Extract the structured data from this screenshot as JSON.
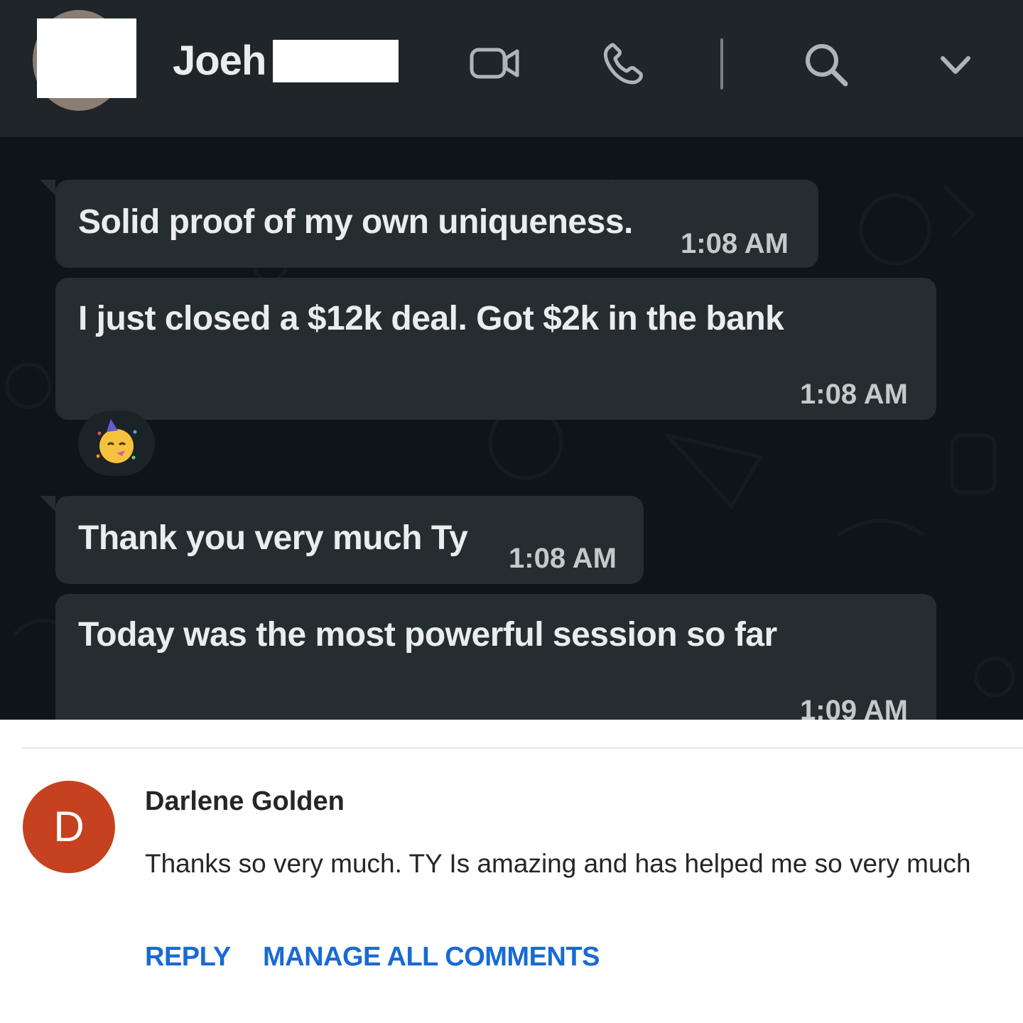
{
  "chat": {
    "contact_name": "Joeh",
    "messages": [
      {
        "text": "Solid proof of my own uniqueness.",
        "time": "1:08 AM"
      },
      {
        "text": "I just closed a $12k deal. Got $2k in the bank",
        "time": "1:08 AM"
      },
      {
        "text": "Thank you very much Ty",
        "time": "1:08 AM"
      },
      {
        "text": "Today was the most powerful session so far",
        "time": "1:09 AM"
      }
    ],
    "reaction_emoji": "🥳",
    "colors": {
      "header_bg": "#1f2529",
      "chat_bg": "#0e1418",
      "bubble_bg": "#262d31",
      "text": "#e9edef"
    }
  },
  "comment": {
    "avatar_letter": "D",
    "author": "Darlene Golden",
    "text": "Thanks so very much. TY Is amazing and has helped me so very much",
    "actions": {
      "reply": "REPLY",
      "manage": "MANAGE ALL COMMENTS"
    },
    "colors": {
      "avatar_bg": "#c5411f",
      "link": "#1a6ad3"
    }
  }
}
